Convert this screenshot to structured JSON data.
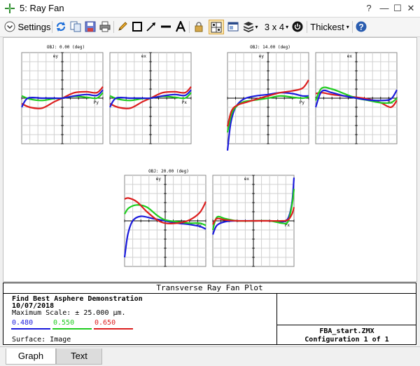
{
  "window": {
    "title": "5: Ray Fan",
    "controls": [
      "?",
      "—",
      "☐",
      "✕"
    ]
  },
  "toolbar": {
    "settings_label": "Settings",
    "layout_label": "3 x 4",
    "line_label": "Thickest"
  },
  "plots": {
    "obj0": "OBJ: 0.00 (deg)",
    "obj1": "OBJ: 14.00 (deg)",
    "obj2": "OBJ: 20.00 (deg)",
    "ey": "ey",
    "ex": "ex",
    "py": "Py",
    "px": "Px"
  },
  "info": {
    "header": "Transverse Ray Fan Plot",
    "title": "Find Best Asphere Demonstration",
    "date": "10/07/2018",
    "scale": "Maximum Scale: ± 25.000 µm.",
    "wavelengths": [
      {
        "label": "0.480",
        "color": "#1a1adc"
      },
      {
        "label": "0.550",
        "color": "#1ecc1e"
      },
      {
        "label": "0.650",
        "color": "#dc1e1e"
      }
    ],
    "surface": "Surface: Image",
    "file": "FBA_start.ZMX",
    "config": "Configuration 1 of 1"
  },
  "tabs": [
    {
      "label": "Graph"
    },
    {
      "label": "Text"
    }
  ]
}
